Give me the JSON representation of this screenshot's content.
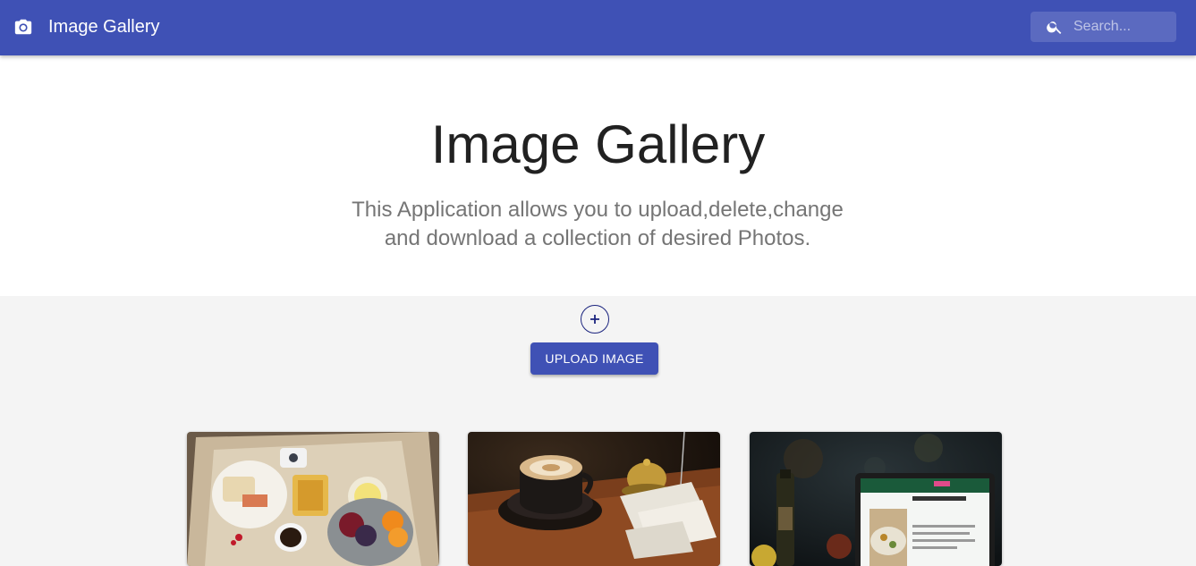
{
  "appbar": {
    "title": "Image Gallery",
    "icon": "camera-icon",
    "color": "#3f51b5",
    "search": {
      "placeholder": "Search...",
      "icon": "search-icon"
    }
  },
  "hero": {
    "heading": "Image Gallery",
    "line1": "This Application allows you to upload,delete,change",
    "line2": "and download a collection of desired Photos."
  },
  "actions": {
    "add_icon": "plus-circle-icon",
    "upload_label": "UPLOAD IMAGE"
  },
  "gallery": {
    "images": [
      {
        "name": "breakfast-flatlay-photo"
      },
      {
        "name": "latte-coffee-photo"
      },
      {
        "name": "laptop-food-blog-photo"
      }
    ]
  }
}
